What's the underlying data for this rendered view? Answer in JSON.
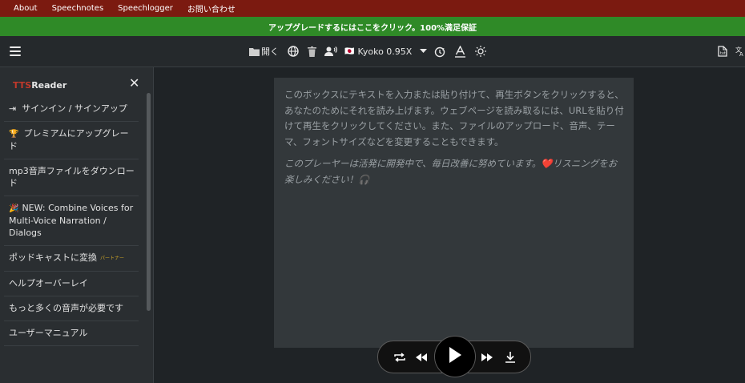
{
  "topnav": {
    "links": [
      "About",
      "Speechnotes",
      "Speechlogger",
      "お問い合わせ"
    ]
  },
  "banner": {
    "text": "アップグレードするにはここをクリック。100%満足保証"
  },
  "toolbar": {
    "open_label": "開く",
    "voice_label": "Kyoko 0.95X",
    "voice_flag": "🇯🇵"
  },
  "sidebar": {
    "title_prefix": "TTS",
    "title_suffix": "Reader",
    "items": [
      {
        "label": "サインイン / サインアップ",
        "icon": "sign-in-icon"
      },
      {
        "label": "プレミアムにアップグレード",
        "icon": "trophy-icon"
      },
      {
        "label": "mp3音声ファイルをダウンロード"
      },
      {
        "label": "NEW: Combine Voices for Multi-Voice Narration / Dialogs",
        "icon": "party-popper-icon"
      },
      {
        "label": "ポッドキャストに変換",
        "badge": "パートナー"
      },
      {
        "label": "ヘルプオーバーレイ"
      },
      {
        "label": "もっと多くの音声が必要です"
      },
      {
        "label": "ユーザーマニュアル"
      }
    ]
  },
  "editor": {
    "placeholder": "このボックスにテキストを入力または貼り付けて、再生ボタンをクリックすると、あなたのためにそれを読み上げます。ウェブページを読み取るには、URLを貼り付けて再生をクリックしてください。また、ファイルのアップロード、音声、テーマ、フォントサイズなどを変更することもできます。",
    "note": "このプレーヤーは活発に開発中で、毎日改善に努めています。❤️リスニングをお楽しみください！🎧"
  },
  "colors": {
    "topnav_bg": "#7b1a10",
    "banner_bg": "#2f8a27",
    "brand_tts": "#c0392b"
  }
}
